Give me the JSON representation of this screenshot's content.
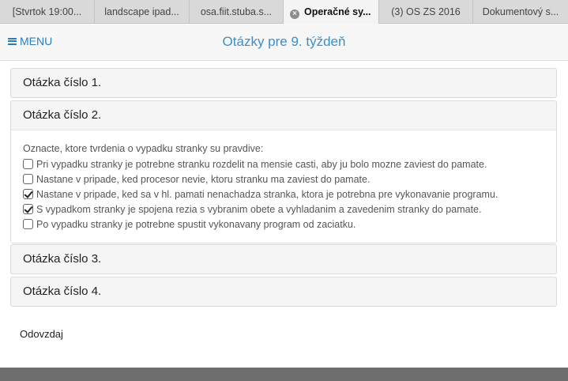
{
  "tabs": [
    {
      "label": "[Stvrtok 19:00...",
      "active": false
    },
    {
      "label": "landscape ipad...",
      "active": false
    },
    {
      "label": "osa.fiit.stuba.s...",
      "active": false
    },
    {
      "label": "Operačné sy...",
      "active": true
    },
    {
      "label": "(3) OS ZS 2016",
      "active": false
    },
    {
      "label": "Dokumentový s...",
      "active": false
    }
  ],
  "header": {
    "menu_label": "MENU",
    "title": "Otázky pre 9. týždeň"
  },
  "questions": [
    {
      "title": "Otázka číslo 1."
    },
    {
      "title": "Otázka číslo 2.",
      "text": "Oznacte, ktore tvrdenia o vypadku stranky su pravdive:",
      "options": [
        {
          "label": "Pri vypadku stranky je potrebne stranku rozdelit na mensie casti, aby ju bolo mozne zaviest do pamate.",
          "checked": false
        },
        {
          "label": "Nastane v pripade, ked procesor nevie, ktoru stranku ma zaviest do pamate.",
          "checked": false
        },
        {
          "label": "Nastane v pripade, ked sa v hl. pamati nenachadza stranka, ktora je potrebna pre vykonavanie programu.",
          "checked": true
        },
        {
          "label": "S vypadkom stranky je spojena rezia s vybranim obete a vyhladanim a zavedenim stranky do pamate.",
          "checked": true
        },
        {
          "label": "Po vypadku stranky je potrebne spustit vykonavany program od zaciatku.",
          "checked": false
        }
      ]
    },
    {
      "title": "Otázka číslo 3."
    },
    {
      "title": "Otázka číslo 4."
    }
  ],
  "submit_label": "Odovzdaj"
}
